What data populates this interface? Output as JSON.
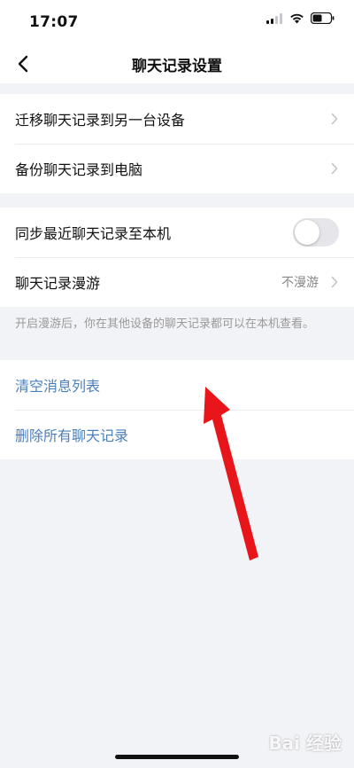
{
  "status_bar": {
    "time": "17:07"
  },
  "nav": {
    "title": "聊天记录设置"
  },
  "groups": [
    {
      "rows": [
        {
          "label": "迁移聊天记录到另一台设备"
        },
        {
          "label": "备份聊天记录到电脑"
        }
      ]
    },
    {
      "rows": [
        {
          "label": "同步最近聊天记录至本机",
          "toggle_on": false
        },
        {
          "label": "聊天记录漫游",
          "value": "不漫游"
        }
      ]
    },
    {
      "rows": [
        {
          "label": "清空消息列表"
        },
        {
          "label": "删除所有聊天记录"
        }
      ]
    }
  ],
  "hint": "开启漫游后，你在其他设备的聊天记录都可以在本机查看。",
  "colors": {
    "link_blue": "#4a7fbc",
    "arrow_red": "#e8151b",
    "background": "#f2f3f7"
  },
  "icons": {
    "back": "chevron-left-icon",
    "row_chevron": "chevron-right-icon",
    "signal": "signal-icon",
    "wifi": "wifi-icon",
    "battery": "battery-icon"
  },
  "watermark": "Bai 经验"
}
